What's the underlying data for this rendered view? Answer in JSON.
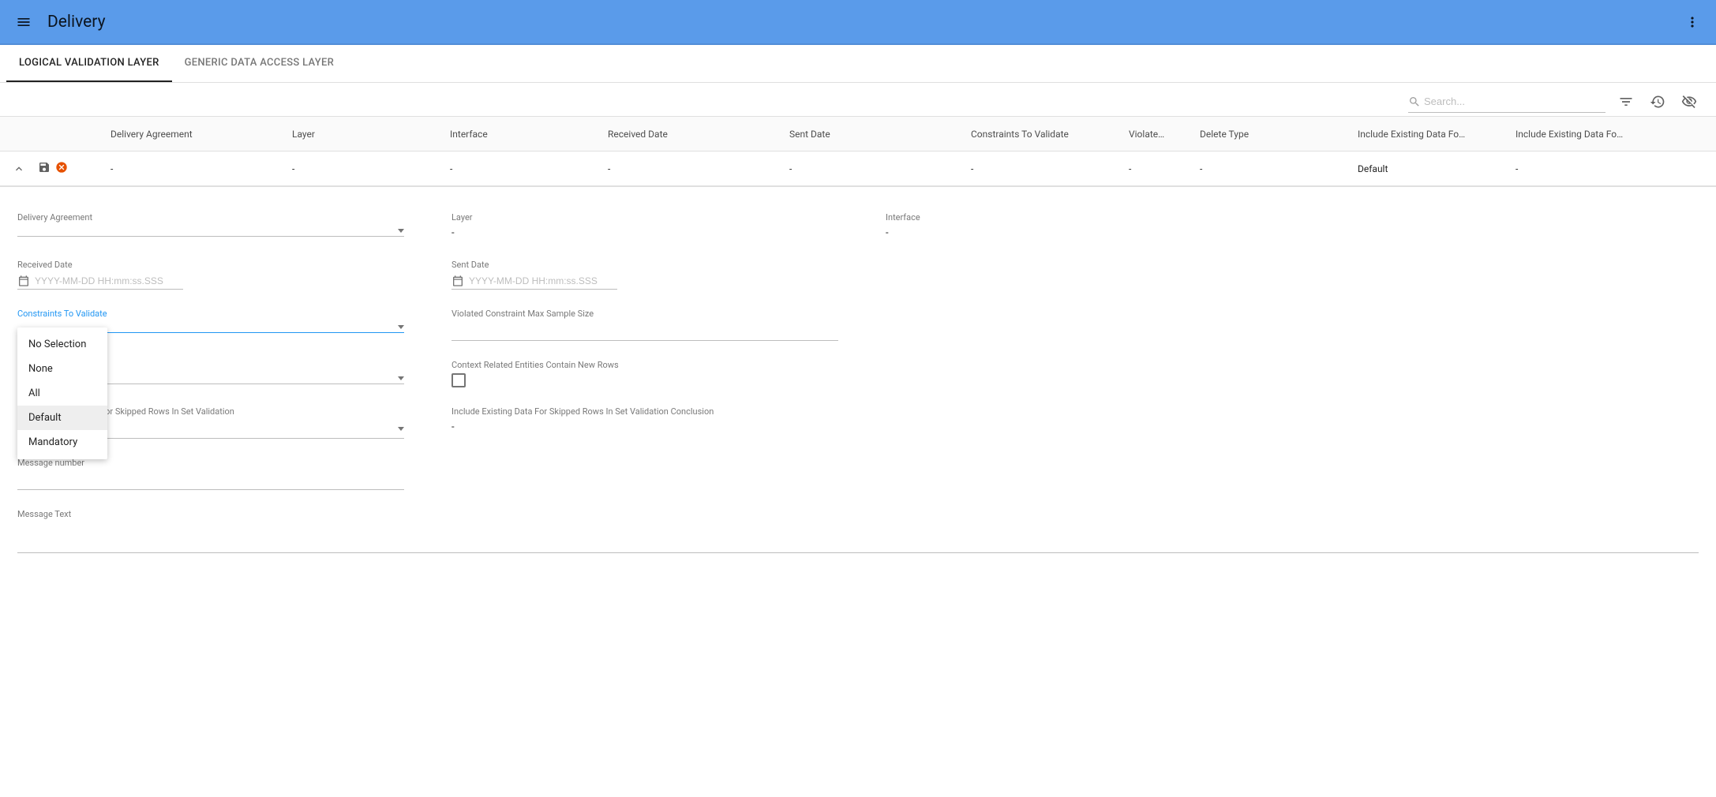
{
  "appbar": {
    "title": "Delivery"
  },
  "tabs": [
    {
      "label": "LOGICAL VALIDATION LAYER",
      "active": true
    },
    {
      "label": "GENERIC DATA ACCESS LAYER",
      "active": false
    }
  ],
  "search": {
    "placeholder": "Search..."
  },
  "table": {
    "columns": [
      "Delivery Agreement",
      "Layer",
      "Interface",
      "Received Date",
      "Sent Date",
      "Constraints To Validate",
      "Violate…",
      "Delete Type",
      "Include Existing Data Fo…",
      "Include Existing Data Fo…"
    ],
    "row": {
      "c1": "-",
      "c2": "-",
      "c3": "-",
      "c4": "-",
      "c5": "-",
      "c6": "-",
      "c7": "-",
      "c8": "-",
      "c9": "Default",
      "c10": "-"
    }
  },
  "form": {
    "deliveryAgreement": {
      "label": "Delivery Agreement",
      "value": ""
    },
    "layer": {
      "label": "Layer",
      "value": "-"
    },
    "interface": {
      "label": "Interface",
      "value": "-"
    },
    "receivedDate": {
      "label": "Received Date",
      "placeholder": "YYYY-MM-DD HH:mm:ss.SSS"
    },
    "sentDate": {
      "label": "Sent Date",
      "placeholder": "YYYY-MM-DD HH:mm:ss.SSS"
    },
    "constraints": {
      "label": "Constraints To Validate",
      "options": [
        "No Selection",
        "None",
        "All",
        "Default",
        "Mandatory"
      ],
      "selectedIndex": 3
    },
    "violatedMax": {
      "label": "Violated Constraint Max Sample Size",
      "value": ""
    },
    "deleteTypeHidden": {
      "label": "",
      "value": ""
    },
    "contextRelated": {
      "label": "Context Related Entities Contain New Rows",
      "checked": false
    },
    "includeExisting": {
      "label": "Include Existing Data For Skipped Rows In Set Validation",
      "value": "Default"
    },
    "includeExistingConclusion": {
      "label": "Include Existing Data For Skipped Rows In Set Validation Conclusion",
      "value": "-"
    },
    "messageNumber": {
      "label": "Message number",
      "value": ""
    },
    "messageText": {
      "label": "Message Text",
      "value": ""
    }
  }
}
